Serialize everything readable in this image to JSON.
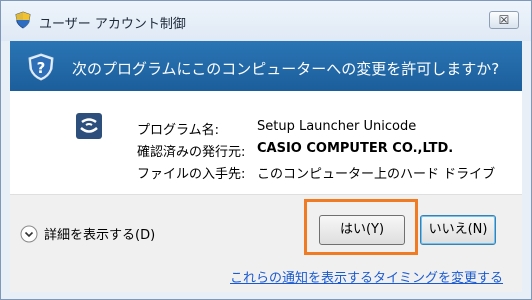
{
  "window": {
    "title": "ユーザー アカウント制御",
    "close_label": "☒"
  },
  "banner": {
    "question": "次のプログラムにこのコンピューターへの変更を許可しますか?"
  },
  "details": {
    "program_name_label": "プログラム名:",
    "program_name_value": "Setup Launcher Unicode",
    "publisher_label": "確認済みの発行元:",
    "publisher_value": "CASIO COMPUTER CO.,LTD.",
    "origin_label": "ファイルの入手先:",
    "origin_value": "このコンピューター上のハード ドライブ"
  },
  "footer": {
    "show_details_label": "詳細を表示する(D)",
    "yes_label": "はい(Y)",
    "no_label": "いいえ(N)",
    "notification_link": "これらの通知を表示するタイミングを変更する"
  },
  "colors": {
    "banner": "#1c5e9c",
    "highlight": "#f07b22",
    "link": "#1a5ad0"
  }
}
